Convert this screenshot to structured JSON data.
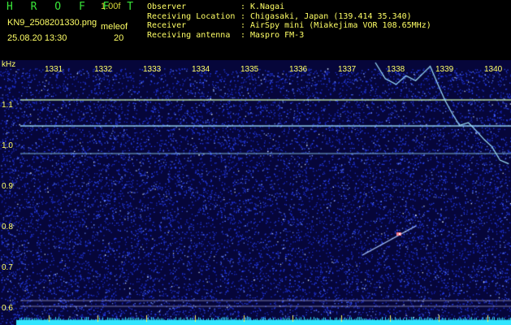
{
  "header": {
    "brand": "H R O F F T",
    "version": "1.00f",
    "filename": "KN9_2508201330.png",
    "field_header": "meleof",
    "timestamp": "25.08.20 13:30",
    "field_value": "20",
    "info_rows": [
      {
        "key": "Observer",
        "sep": ":",
        "value": "K.Nagai"
      },
      {
        "key": "Receiving Location",
        "sep": ":",
        "value": "Chigasaki, Japan (139.414 35.340)"
      },
      {
        "key": "Receiver",
        "sep": ":",
        "value": "AirSpy mini (Miakejima VOR 108.65MHz)"
      },
      {
        "key": "Receiving antenna",
        "sep": ":",
        "value": "Maspro FM-3"
      }
    ]
  },
  "spectrogram": {
    "y_unit": "kHz",
    "y_ticks": [
      "1.1",
      "1.0",
      "0.9",
      "0.8",
      "0.7",
      "0.6"
    ],
    "x_ticks": [
      "1331",
      "1332",
      "1333",
      "1334",
      "1335",
      "1336",
      "1337",
      "1338",
      "1339",
      "1340"
    ],
    "colors": {
      "background": "#06063a",
      "noise": "#2f4cff",
      "carrier": "#9fe3ff",
      "meteor": "#ff7a8a",
      "text": "#ffff66",
      "bottom_band": "#33e6ff"
    }
  }
}
